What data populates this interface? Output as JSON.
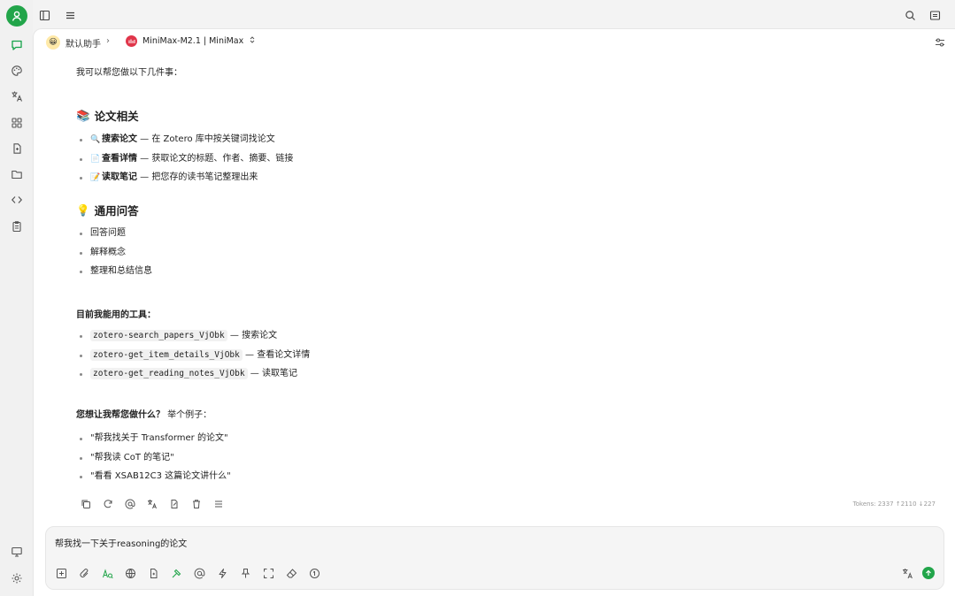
{
  "header": {
    "assistant_name": "默认助手",
    "model_name": "MiniMax-M2.1 | MiniMax"
  },
  "message": {
    "intro": "我可以帮您做以下几件事：",
    "section1": {
      "emoji": "📚",
      "title": "论文相关",
      "items": [
        {
          "emoji": "🔍",
          "bold": "搜索论文",
          "rest": " — 在 Zotero 库中按关键词找论文"
        },
        {
          "emoji": "📄",
          "bold": "查看详情",
          "rest": " — 获取论文的标题、作者、摘要、链接"
        },
        {
          "emoji": "📝",
          "bold": "读取笔记",
          "rest": " — 把您存的读书笔记整理出来"
        }
      ]
    },
    "section2": {
      "emoji": "💡",
      "title": "通用问答",
      "items": [
        "回答问题",
        "解释概念",
        "整理和总结信息"
      ]
    },
    "tools_heading": "目前我能用的工具：",
    "tools": [
      {
        "code": "zotero-search_papers_VjObk",
        "desc": " — 搜索论文"
      },
      {
        "code": "zotero-get_item_details_VjObk",
        "desc": " — 查看论文详情"
      },
      {
        "code": "zotero-get_reading_notes_VjObk",
        "desc": " — 读取笔记"
      }
    ],
    "ask_heading_bold": "您想让我帮您做什么？",
    "ask_heading_rest": " 举个例子：",
    "examples": [
      "\"帮我找关于 Transformer 的论文\"",
      "\"帮我读 CoT 的笔记\"",
      "\"看看 XSAB12C3 这篇论文讲什么\""
    ],
    "tokens": "Tokens: 2337 ↑2110 ↓227"
  },
  "input": {
    "value": "帮我找一下关于reasoning的论文"
  },
  "colors": {
    "accent": "#22a54a",
    "model_logo": "#e0354a"
  }
}
